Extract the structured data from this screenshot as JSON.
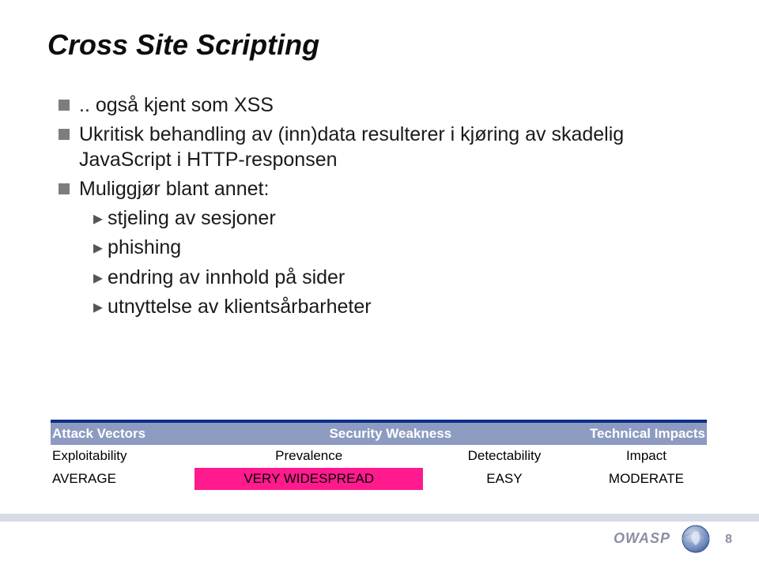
{
  "title": "Cross Site Scripting",
  "bullets": [
    {
      "level": 1,
      "text": ".. også kjent som XSS"
    },
    {
      "level": 1,
      "text": "Ukritisk behandling av (inn)data resulterer i kjøring av skadelig JavaScript i HTTP-responsen"
    },
    {
      "level": 1,
      "text": "Muliggjør blant annet:"
    },
    {
      "level": 2,
      "text": "stjeling av sesjoner"
    },
    {
      "level": 2,
      "text": "phishing"
    },
    {
      "level": 2,
      "text": "endring av innhold på sider"
    },
    {
      "level": 2,
      "text": "utnyttelse av klientsårbarheter"
    }
  ],
  "risk_table": {
    "headers": {
      "attack": "Attack Vectors",
      "weakness": "Security Weakness",
      "impacts": "Technical Impacts"
    },
    "row2": {
      "exploit_label": "Exploitability",
      "prevalence_label": "Prevalence",
      "detect_label": "Detectability",
      "impact_label": "Impact"
    },
    "row3": {
      "exploit_value": "AVERAGE",
      "prevalence_value": "VERY WIDESPREAD",
      "detect_value": "EASY",
      "impact_value": "MODERATE"
    }
  },
  "footer": {
    "org": "OWASP",
    "page": "8"
  }
}
